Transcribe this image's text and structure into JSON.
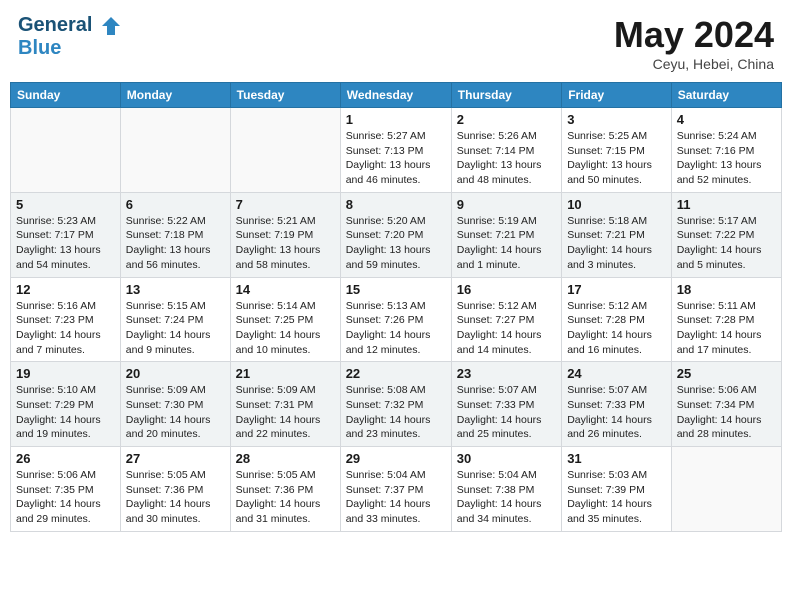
{
  "header": {
    "logo_line1": "General",
    "logo_line2": "Blue",
    "month": "May 2024",
    "location": "Ceyu, Hebei, China"
  },
  "weekdays": [
    "Sunday",
    "Monday",
    "Tuesday",
    "Wednesday",
    "Thursday",
    "Friday",
    "Saturday"
  ],
  "weeks": [
    [
      {
        "day": "",
        "info": ""
      },
      {
        "day": "",
        "info": ""
      },
      {
        "day": "",
        "info": ""
      },
      {
        "day": "1",
        "info": "Sunrise: 5:27 AM\nSunset: 7:13 PM\nDaylight: 13 hours\nand 46 minutes."
      },
      {
        "day": "2",
        "info": "Sunrise: 5:26 AM\nSunset: 7:14 PM\nDaylight: 13 hours\nand 48 minutes."
      },
      {
        "day": "3",
        "info": "Sunrise: 5:25 AM\nSunset: 7:15 PM\nDaylight: 13 hours\nand 50 minutes."
      },
      {
        "day": "4",
        "info": "Sunrise: 5:24 AM\nSunset: 7:16 PM\nDaylight: 13 hours\nand 52 minutes."
      }
    ],
    [
      {
        "day": "5",
        "info": "Sunrise: 5:23 AM\nSunset: 7:17 PM\nDaylight: 13 hours\nand 54 minutes."
      },
      {
        "day": "6",
        "info": "Sunrise: 5:22 AM\nSunset: 7:18 PM\nDaylight: 13 hours\nand 56 minutes."
      },
      {
        "day": "7",
        "info": "Sunrise: 5:21 AM\nSunset: 7:19 PM\nDaylight: 13 hours\nand 58 minutes."
      },
      {
        "day": "8",
        "info": "Sunrise: 5:20 AM\nSunset: 7:20 PM\nDaylight: 13 hours\nand 59 minutes."
      },
      {
        "day": "9",
        "info": "Sunrise: 5:19 AM\nSunset: 7:21 PM\nDaylight: 14 hours\nand 1 minute."
      },
      {
        "day": "10",
        "info": "Sunrise: 5:18 AM\nSunset: 7:21 PM\nDaylight: 14 hours\nand 3 minutes."
      },
      {
        "day": "11",
        "info": "Sunrise: 5:17 AM\nSunset: 7:22 PM\nDaylight: 14 hours\nand 5 minutes."
      }
    ],
    [
      {
        "day": "12",
        "info": "Sunrise: 5:16 AM\nSunset: 7:23 PM\nDaylight: 14 hours\nand 7 minutes."
      },
      {
        "day": "13",
        "info": "Sunrise: 5:15 AM\nSunset: 7:24 PM\nDaylight: 14 hours\nand 9 minutes."
      },
      {
        "day": "14",
        "info": "Sunrise: 5:14 AM\nSunset: 7:25 PM\nDaylight: 14 hours\nand 10 minutes."
      },
      {
        "day": "15",
        "info": "Sunrise: 5:13 AM\nSunset: 7:26 PM\nDaylight: 14 hours\nand 12 minutes."
      },
      {
        "day": "16",
        "info": "Sunrise: 5:12 AM\nSunset: 7:27 PM\nDaylight: 14 hours\nand 14 minutes."
      },
      {
        "day": "17",
        "info": "Sunrise: 5:12 AM\nSunset: 7:28 PM\nDaylight: 14 hours\nand 16 minutes."
      },
      {
        "day": "18",
        "info": "Sunrise: 5:11 AM\nSunset: 7:28 PM\nDaylight: 14 hours\nand 17 minutes."
      }
    ],
    [
      {
        "day": "19",
        "info": "Sunrise: 5:10 AM\nSunset: 7:29 PM\nDaylight: 14 hours\nand 19 minutes."
      },
      {
        "day": "20",
        "info": "Sunrise: 5:09 AM\nSunset: 7:30 PM\nDaylight: 14 hours\nand 20 minutes."
      },
      {
        "day": "21",
        "info": "Sunrise: 5:09 AM\nSunset: 7:31 PM\nDaylight: 14 hours\nand 22 minutes."
      },
      {
        "day": "22",
        "info": "Sunrise: 5:08 AM\nSunset: 7:32 PM\nDaylight: 14 hours\nand 23 minutes."
      },
      {
        "day": "23",
        "info": "Sunrise: 5:07 AM\nSunset: 7:33 PM\nDaylight: 14 hours\nand 25 minutes."
      },
      {
        "day": "24",
        "info": "Sunrise: 5:07 AM\nSunset: 7:33 PM\nDaylight: 14 hours\nand 26 minutes."
      },
      {
        "day": "25",
        "info": "Sunrise: 5:06 AM\nSunset: 7:34 PM\nDaylight: 14 hours\nand 28 minutes."
      }
    ],
    [
      {
        "day": "26",
        "info": "Sunrise: 5:06 AM\nSunset: 7:35 PM\nDaylight: 14 hours\nand 29 minutes."
      },
      {
        "day": "27",
        "info": "Sunrise: 5:05 AM\nSunset: 7:36 PM\nDaylight: 14 hours\nand 30 minutes."
      },
      {
        "day": "28",
        "info": "Sunrise: 5:05 AM\nSunset: 7:36 PM\nDaylight: 14 hours\nand 31 minutes."
      },
      {
        "day": "29",
        "info": "Sunrise: 5:04 AM\nSunset: 7:37 PM\nDaylight: 14 hours\nand 33 minutes."
      },
      {
        "day": "30",
        "info": "Sunrise: 5:04 AM\nSunset: 7:38 PM\nDaylight: 14 hours\nand 34 minutes."
      },
      {
        "day": "31",
        "info": "Sunrise: 5:03 AM\nSunset: 7:39 PM\nDaylight: 14 hours\nand 35 minutes."
      },
      {
        "day": "",
        "info": ""
      }
    ]
  ]
}
